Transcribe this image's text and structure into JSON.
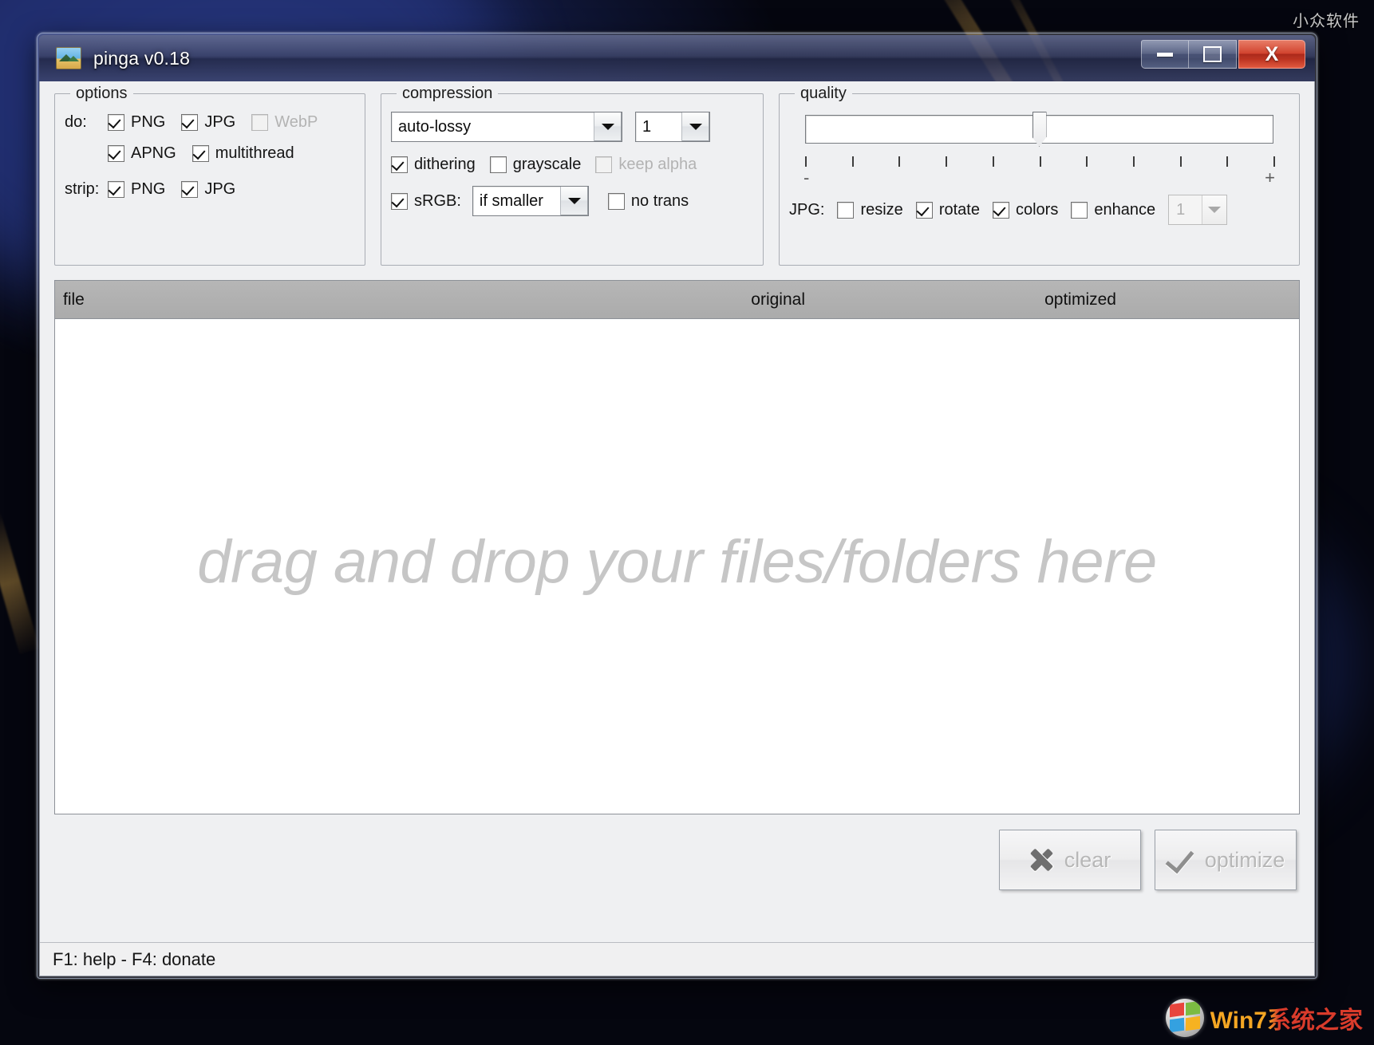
{
  "window": {
    "title": "pinga v0.18",
    "icon": "image-icon",
    "controls": {
      "minimize": "minimize-icon",
      "maximize": "maximize-icon",
      "close": "X"
    }
  },
  "options": {
    "title": "options",
    "do_label": "do:",
    "strip_label": "strip:",
    "do_items": [
      {
        "label": "PNG",
        "checked": true,
        "enabled": true
      },
      {
        "label": "JPG",
        "checked": true,
        "enabled": true
      },
      {
        "label": "WebP",
        "checked": false,
        "enabled": false
      },
      {
        "label": "APNG",
        "checked": true,
        "enabled": true
      },
      {
        "label": "multithread",
        "checked": true,
        "enabled": true
      }
    ],
    "strip_items": [
      {
        "label": "PNG",
        "checked": true,
        "enabled": true
      },
      {
        "label": "JPG",
        "checked": true,
        "enabled": true
      }
    ]
  },
  "compression": {
    "title": "compression",
    "mode": {
      "value": "auto-lossy",
      "options": [
        "auto-lossy"
      ]
    },
    "level": {
      "value": "1",
      "options": [
        "1"
      ]
    },
    "checkboxes": [
      {
        "label": "dithering",
        "checked": true,
        "enabled": true
      },
      {
        "label": "grayscale",
        "checked": false,
        "enabled": true
      },
      {
        "label": "keep alpha",
        "checked": false,
        "enabled": false
      },
      {
        "label": "sRGB:",
        "checked": true,
        "enabled": true
      },
      {
        "label": "no trans",
        "checked": false,
        "enabled": true
      }
    ],
    "srgb_mode": {
      "value": "if smaller",
      "options": [
        "if smaller"
      ]
    }
  },
  "quality": {
    "title": "quality",
    "slider": {
      "value": 6,
      "min": 1,
      "max": 11,
      "ticks": 11,
      "minus": "-",
      "plus": "+"
    },
    "jpg_label": "JPG:",
    "jpg_items": [
      {
        "label": "resize",
        "checked": false,
        "enabled": true
      },
      {
        "label": "rotate",
        "checked": true,
        "enabled": true
      },
      {
        "label": "colors",
        "checked": true,
        "enabled": true
      },
      {
        "label": "enhance",
        "checked": false,
        "enabled": true
      }
    ],
    "enhance_spin": {
      "value": "1",
      "enabled": false
    }
  },
  "file_list": {
    "columns": [
      "file",
      "original",
      "optimized"
    ],
    "rows": [],
    "empty_message": "drag and drop your files/folders here"
  },
  "actions": {
    "clear": {
      "label": "clear",
      "icon": "x-icon",
      "enabled": false
    },
    "optimize": {
      "label": "optimize",
      "icon": "check-icon",
      "enabled": false
    }
  },
  "statusbar": {
    "text": "F1: help - F4: donate"
  },
  "watermarks": {
    "top_right": "小众软件",
    "bottom_right": "Win7系统之家"
  },
  "colors": {
    "titlebar": "#2c345c",
    "close_button": "#cf3a24",
    "client_bg": "#eff0f2",
    "header_bg": "#b0b0b0",
    "dropzone_text": "#c6c6c6"
  }
}
